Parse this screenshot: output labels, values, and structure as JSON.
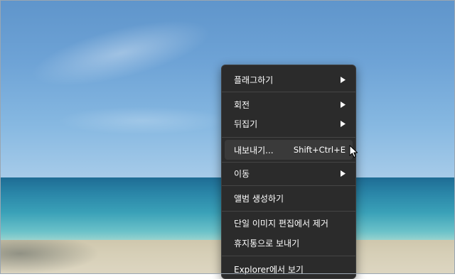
{
  "menu": {
    "items": [
      {
        "label": "플래그하기",
        "submenu": true
      },
      {
        "label": "회전",
        "submenu": true
      },
      {
        "label": "뒤집기",
        "submenu": true
      },
      {
        "label": "내보내기...",
        "shortcut": "Shift+Ctrl+E",
        "hovered": true
      },
      {
        "label": "이동",
        "submenu": true
      },
      {
        "label": "앨범 생성하기"
      },
      {
        "label": "단일 이미지 편집에서 제거"
      },
      {
        "label": "휴지통으로 보내기"
      },
      {
        "label": "Explorer에서 보기"
      }
    ]
  },
  "colors": {
    "menu_background": "#2b2b2b",
    "hover_background": "#3a3a3a",
    "text": "#ffffff",
    "separator": "#454545"
  },
  "icons": [
    "submenu-arrow-icon",
    "mouse-pointer-icon"
  ]
}
